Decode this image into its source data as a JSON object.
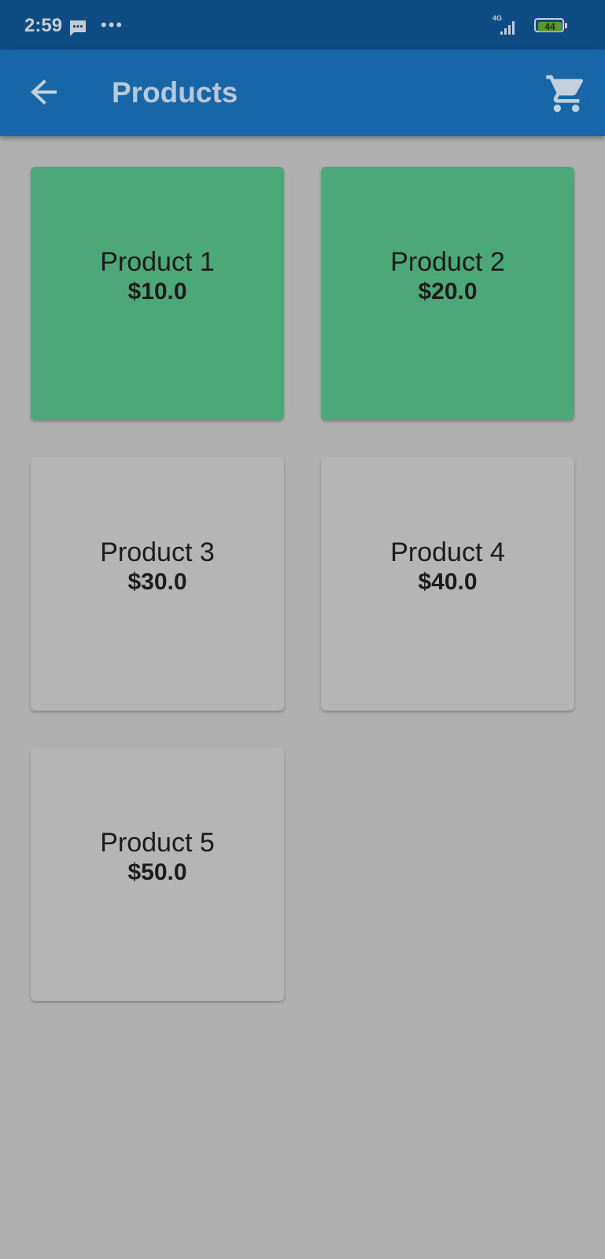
{
  "status_bar": {
    "time": "2:59",
    "network": "4G",
    "battery_level": "44",
    "icons": [
      "message-icon",
      "more-dots-icon",
      "signal-icon",
      "battery-icon"
    ]
  },
  "app_bar": {
    "title": "Products",
    "back_icon": "arrow-left-icon",
    "cart_icon": "shopping-cart-icon"
  },
  "products": [
    {
      "name": "Product 1",
      "price": "$10.0",
      "selected": true
    },
    {
      "name": "Product 2",
      "price": "$20.0",
      "selected": true
    },
    {
      "name": "Product 3",
      "price": "$30.0",
      "selected": false
    },
    {
      "name": "Product 4",
      "price": "$40.0",
      "selected": false
    },
    {
      "name": "Product 5",
      "price": "$50.0",
      "selected": false
    }
  ],
  "colors": {
    "status_bar": "#0f4c84",
    "app_bar": "#1766a8",
    "background": "#b0b0b0",
    "selected_card": "#4ca878",
    "unselected_card": "#b5b5b5"
  }
}
